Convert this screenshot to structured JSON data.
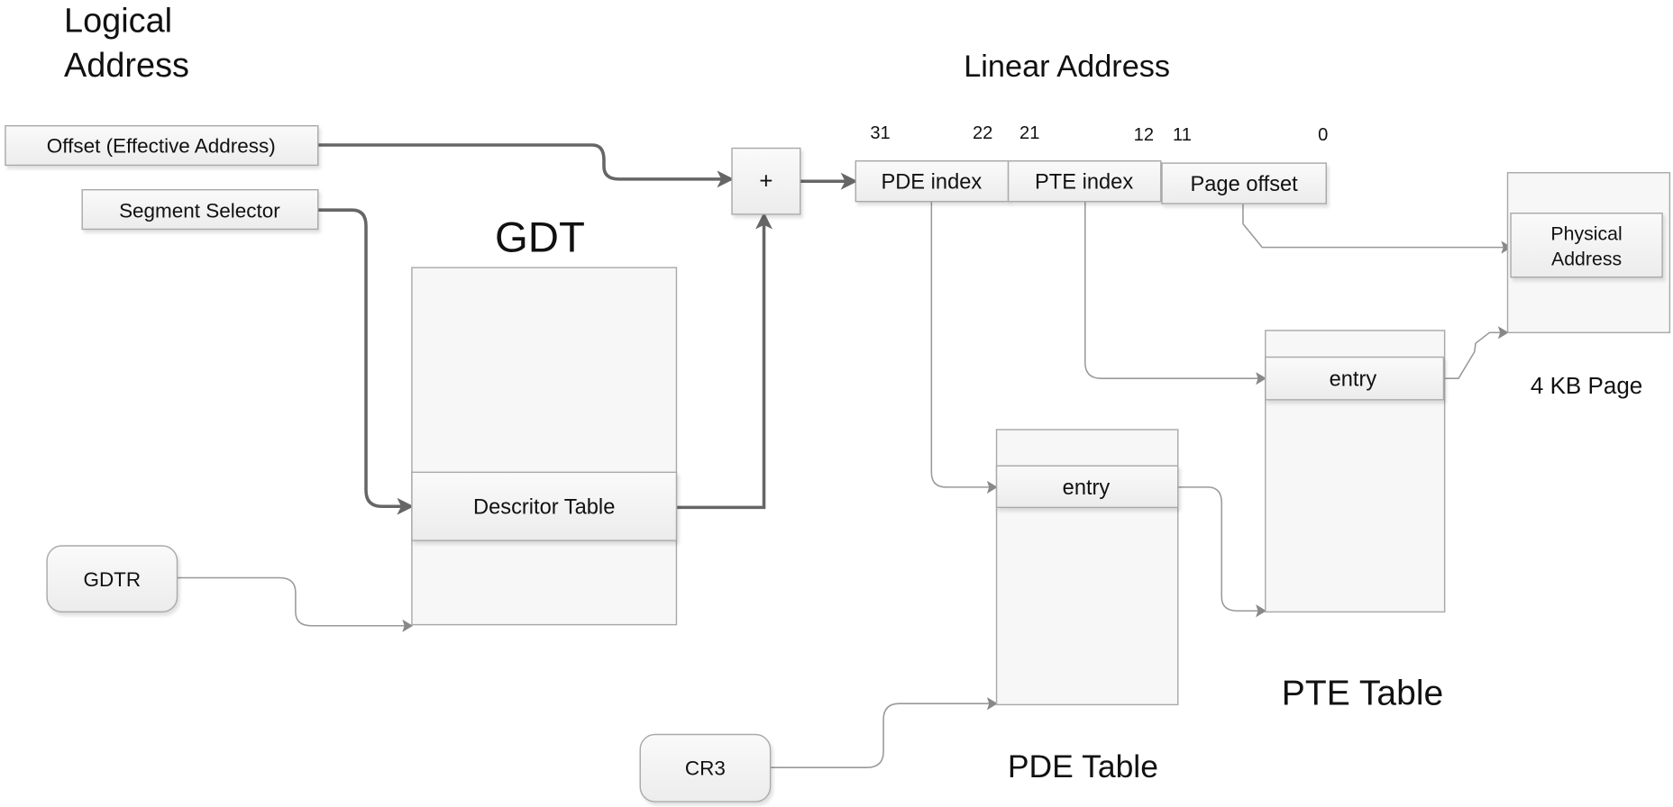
{
  "titles": {
    "logical_line1": "Logical",
    "logical_line2": "Address",
    "linear": "Linear Address",
    "gdt": "GDT",
    "pde_table": "PDE Table",
    "pte_table": "PTE Table",
    "page": "4 KB Page"
  },
  "inputs": {
    "offset": "Offset (Effective Address)",
    "segment_selector": "Segment Selector",
    "gdtr": "GDTR",
    "cr3": "CR3",
    "adder": "+"
  },
  "linear_fields": [
    {
      "label": "PDE index",
      "high_bit": "31",
      "low_bit": "22"
    },
    {
      "label": "PTE index",
      "high_bit": "21",
      "low_bit": "12"
    },
    {
      "label": "Page offset",
      "high_bit": "11",
      "low_bit": "0"
    }
  ],
  "tables": {
    "gdt_entry": "Descritor Table",
    "pde_entry": "entry",
    "pte_entry": "entry",
    "physical_address_line1": "Physical",
    "physical_address_line2": "Address"
  }
}
